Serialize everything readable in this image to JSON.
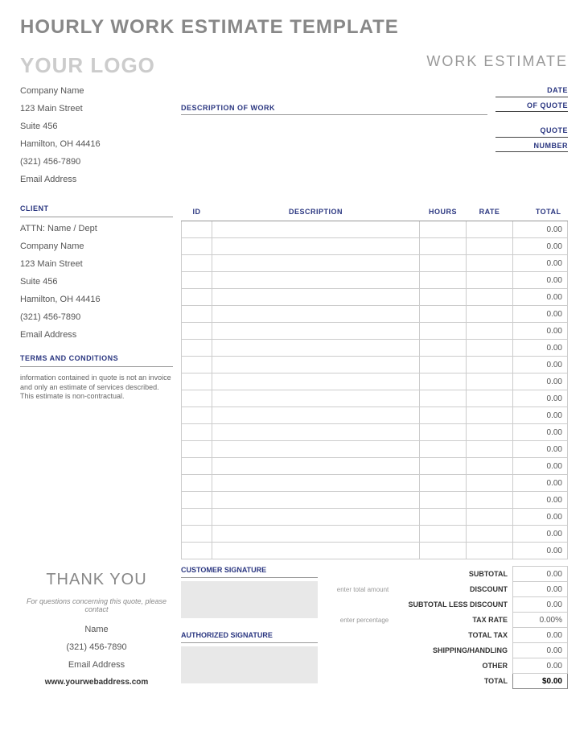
{
  "title": "HOURLY WORK ESTIMATE TEMPLATE",
  "logo": "YOUR LOGO",
  "work_estimate": "WORK ESTIMATE",
  "company": {
    "name": "Company Name",
    "street": "123 Main Street",
    "suite": "Suite 456",
    "city": "Hamilton, OH  44416",
    "phone": "(321) 456-7890",
    "email": "Email Address"
  },
  "desc_label": "DESCRIPTION OF WORK",
  "date_quote": {
    "date1": "DATE",
    "date2": "OF QUOTE",
    "quote1": "QUOTE",
    "quote2": "NUMBER"
  },
  "client_head": "CLIENT",
  "client": {
    "attn": "ATTN: Name / Dept",
    "name": "Company Name",
    "street": "123 Main Street",
    "suite": "Suite 456",
    "city": "Hamilton, OH  44416",
    "phone": "(321) 456-7890",
    "email": "Email Address"
  },
  "terms_head": "TERMS AND CONDITIONS",
  "terms_text": "information contained in quote is not an invoice and only an estimate of services described. This estimate is non-contractual.",
  "cols": {
    "id": "ID",
    "desc": "DESCRIPTION",
    "hours": "HOURS",
    "rate": "RATE",
    "total": "TOTAL"
  },
  "row_total": "0.00",
  "thank": "THANK YOU",
  "contact_text": "For questions concerning this quote, please contact",
  "contact": {
    "name": "Name",
    "phone": "(321) 456-7890",
    "email": "Email Address"
  },
  "website": "www.yourwebaddress.com",
  "sig": {
    "customer": "CUSTOMER SIGNATURE",
    "authorized": "AUTHORIZED SIGNATURE"
  },
  "totals": {
    "subtotal_lbl": "SUBTOTAL",
    "subtotal": "0.00",
    "discount_hint": "enter total amount",
    "discount_lbl": "DISCOUNT",
    "discount": "0.00",
    "subless_lbl": "SUBTOTAL LESS DISCOUNT",
    "subless": "0.00",
    "taxrate_hint": "enter percentage",
    "taxrate_lbl": "TAX RATE",
    "taxrate": "0.00%",
    "totaltax_lbl": "TOTAL TAX",
    "totaltax": "0.00",
    "shipping_lbl": "SHIPPING/HANDLING",
    "shipping": "0.00",
    "other_lbl": "OTHER",
    "other": "0.00",
    "total_lbl": "TOTAL",
    "total": "$0.00"
  }
}
